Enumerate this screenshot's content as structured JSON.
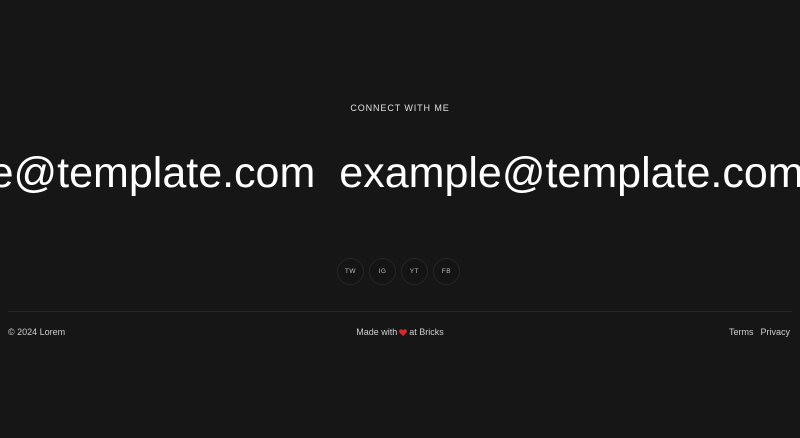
{
  "connect": {
    "heading": "CONNECT WITH ME"
  },
  "marquee": {
    "email": "example@template.com"
  },
  "socials": [
    {
      "label": "TW",
      "icon": "twitter"
    },
    {
      "label": "IG",
      "icon": "instagram"
    },
    {
      "label": "YT",
      "icon": "youtube"
    },
    {
      "label": "FB",
      "icon": "facebook"
    }
  ],
  "footer": {
    "copyright": "© 2024 Lorem",
    "made_with_prefix": "Made with",
    "made_with_suffix": "at Bricks",
    "heart_color": "#e0242c",
    "links": [
      {
        "label": "Terms"
      },
      {
        "label": "Privacy"
      }
    ]
  },
  "colors": {
    "background": "#161616",
    "text": "#ffffff"
  }
}
